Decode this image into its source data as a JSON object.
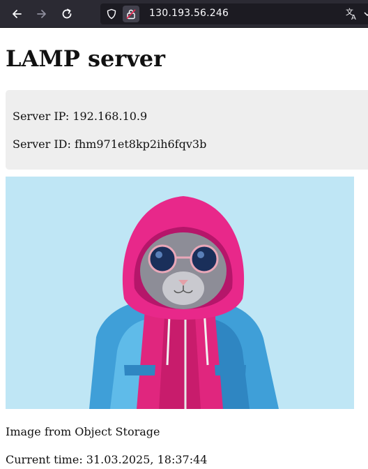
{
  "browser": {
    "url": "130.193.56.246",
    "icons": {
      "back": "back-arrow-icon",
      "forward": "forward-arrow-icon",
      "reload": "reload-icon",
      "tracking": "shield-icon",
      "insecure": "insecure-lock-icon",
      "translate": "translate-icon",
      "menu": "chevron-down-icon"
    },
    "colors": {
      "toolbar_bg": "#2b2a33",
      "urlbar_bg": "#1c1b22",
      "text": "#fbfbfe"
    }
  },
  "page": {
    "title": "LAMP server",
    "server_ip": "Server IP: 192.168.10.9",
    "server_id": "Server ID: fhm971et8kp2ih6fqv3b",
    "image_description": "cat-in-pink-hoodie-and-blue-jacket",
    "image_caption": "Image from Object Storage",
    "current_time": "Current time: 31.03.2025, 18:37:44",
    "colors": {
      "info_box_bg": "#eeeeee",
      "image_bg": "#bfe6f5"
    }
  }
}
